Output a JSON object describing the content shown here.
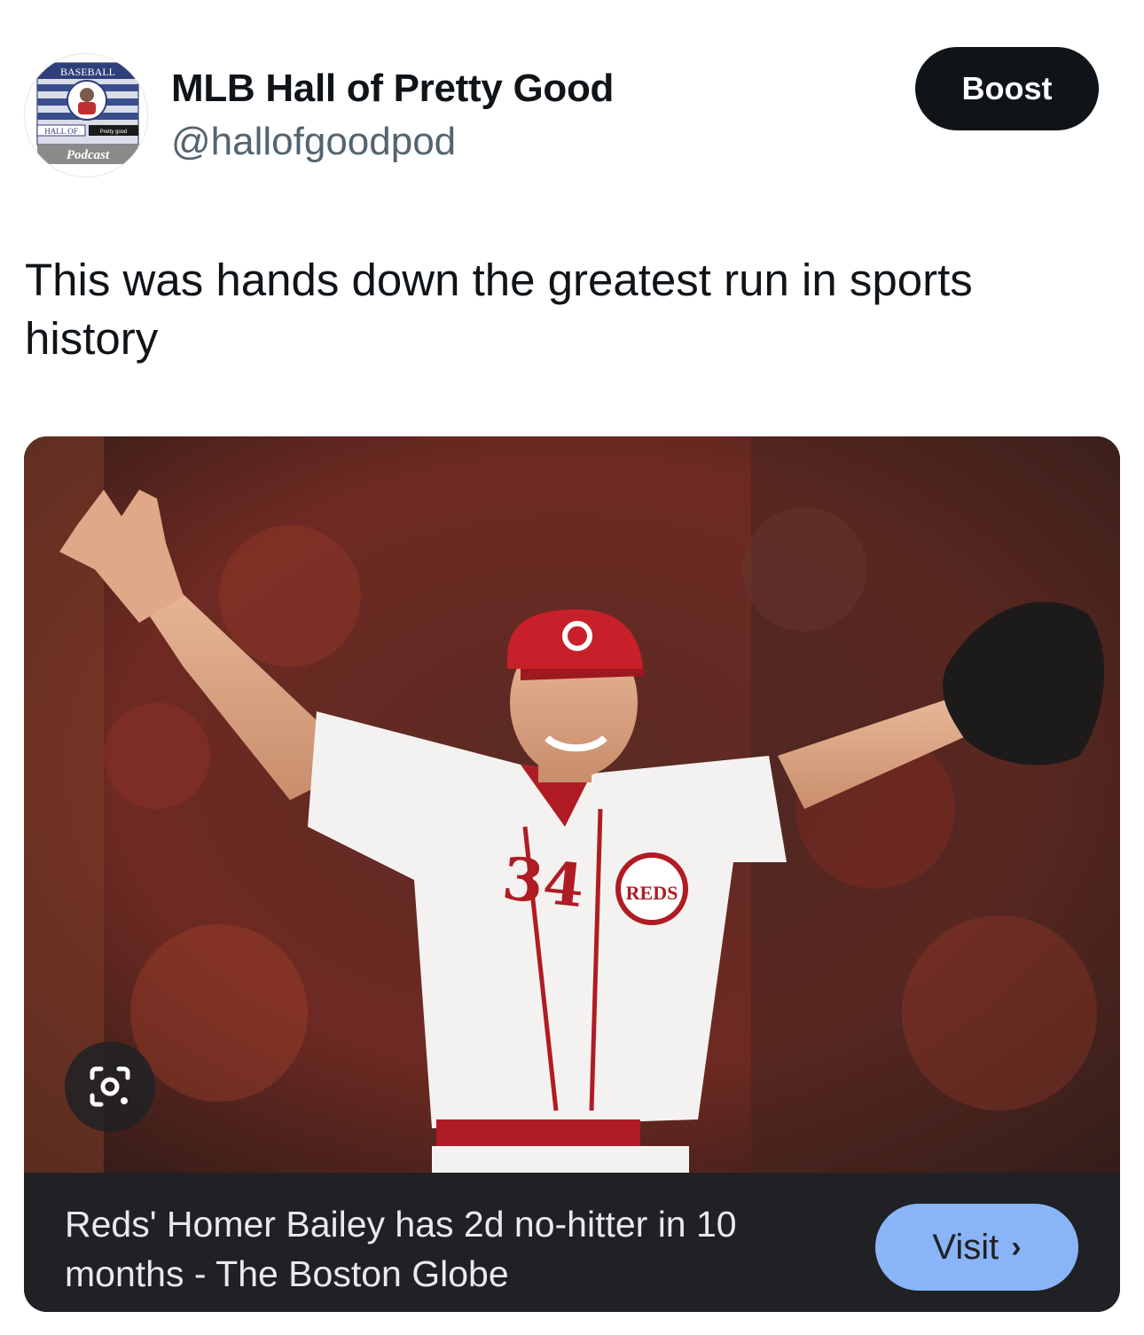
{
  "profile": {
    "display_name": "MLB Hall of Pretty Good",
    "handle": "@hallofgoodpod",
    "avatar": {
      "top_text": "BASEBALL",
      "middle_text": "HALL OF",
      "small_text": "Pretty good",
      "bottom_text": "Podcast"
    }
  },
  "actions": {
    "boost_label": "Boost"
  },
  "tweet": {
    "text": "This was hands down the greatest run in sports history"
  },
  "card": {
    "image_jersey_number": "34",
    "image_logo_text": "REDS",
    "title": "Reds' Homer Bailey has 2d no-hitter in 10 months - The Boston Globe",
    "visit_label": "Visit",
    "visit_icon": "chevron-right-icon",
    "lens_icon": "lens-search-icon"
  },
  "colors": {
    "boost_bg": "#0f1419",
    "handle": "#536471",
    "card_bg": "#202124",
    "visit_bg": "#8ab4f8"
  }
}
